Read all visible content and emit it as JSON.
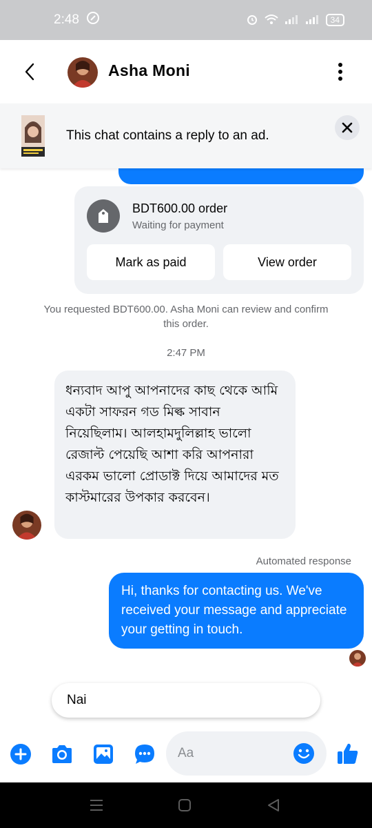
{
  "status_bar": {
    "time": "2:48",
    "battery": "34"
  },
  "header": {
    "contact_name": "Asha Moni"
  },
  "ad_banner": {
    "text": "This chat contains a reply to an ad.",
    "thumb_caption": "#SKINHER"
  },
  "order": {
    "title": "BDT600.00 order",
    "status": "Waiting for payment",
    "mark_paid_label": "Mark as paid",
    "view_order_label": "View order"
  },
  "system_note": "You requested BDT600.00. Asha Moni can review and confirm this order.",
  "timestamp": "2:47 PM",
  "incoming_message": "ধন্যবাদ আপু আপনাদের কাছ থেকে আমি একটা সাফরন গড মিল্ক সাবান নিয়েছিলাম। আলহামদুলিল্লাহ ভালো রেজাল্ট পেয়েছি আশা করি আপনারা এরকম ভালো প্রোডাক্ট দিয়ে আমাদের মত কাস্টমারের উপকার করবেন।",
  "automated_label": "Automated response",
  "outgoing_message": "Hi, thanks for contacting us. We've received your message and appreciate your getting in touch.",
  "quick_reply": "Nai",
  "composer": {
    "placeholder": "Aa"
  },
  "colors": {
    "messenger_blue": "#0a7cff",
    "bubble_gray": "#f0f2f5",
    "status_bar": "#c9cacc"
  },
  "icons": [
    "back-icon",
    "more-vertical-icon",
    "close-icon",
    "tag-icon",
    "plus-icon",
    "camera-icon",
    "image-icon",
    "more-horizontal-icon",
    "emoji-icon",
    "thumbs-up-icon"
  ]
}
